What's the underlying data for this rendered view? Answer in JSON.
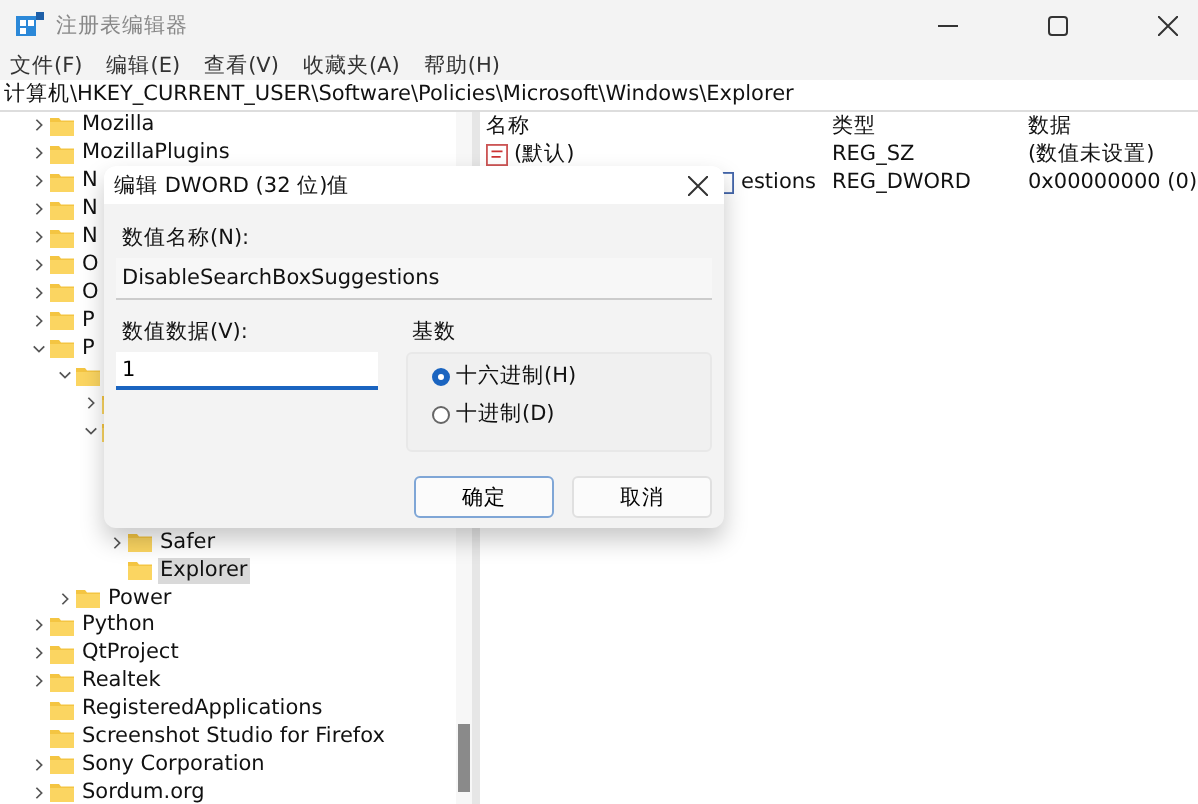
{
  "window": {
    "title": "注册表编辑器"
  },
  "menu": [
    "文件(F)",
    "编辑(E)",
    "查看(V)",
    "收藏夹(A)",
    "帮助(H)"
  ],
  "address": "计算机\\HKEY_CURRENT_USER\\Software\\Policies\\Microsoft\\Windows\\Explorer",
  "tree": [
    {
      "label": "Mozilla",
      "expanded": false,
      "selected": false
    },
    {
      "label": "MozillaPlugins",
      "expanded": false,
      "selected": false
    },
    {
      "label": "N",
      "expanded": false,
      "selected": false
    },
    {
      "label": "N",
      "expanded": false,
      "selected": false
    },
    {
      "label": "N",
      "expanded": false,
      "selected": false
    },
    {
      "label": "O",
      "expanded": false,
      "selected": false
    },
    {
      "label": "O",
      "expanded": false,
      "selected": false
    },
    {
      "label": "P",
      "expanded": false,
      "selected": false
    },
    {
      "label": "P",
      "expanded": true,
      "selected": false,
      "children": [
        {
          "expanded": true,
          "selected": false,
          "children": [
            {
              "expanded": false,
              "selected": false
            },
            {
              "expanded": true,
              "selected": false,
              "children": [
                {
                  "label": "Safer",
                  "expanded": false,
                  "selected": false
                },
                {
                  "label": "Explorer",
                  "selected": true
                }
              ]
            }
          ]
        },
        {
          "label": "Power",
          "expanded": false,
          "selected": false
        }
      ]
    },
    {
      "label": "Python",
      "expanded": false,
      "selected": false
    },
    {
      "label": "QtProject",
      "expanded": false,
      "selected": false
    },
    {
      "label": "Realtek",
      "expanded": false,
      "selected": false
    },
    {
      "label": "RegisteredApplications",
      "selected": false
    },
    {
      "label": "Screenshot Studio for Firefox",
      "selected": false
    },
    {
      "label": "Sony Corporation",
      "expanded": false,
      "selected": false
    },
    {
      "label": "Sordum.org",
      "expanded": false,
      "selected": false
    }
  ],
  "values": {
    "columns": [
      "名称",
      "类型",
      "数据"
    ],
    "rows": [
      {
        "name": "(默认)",
        "type": "REG_SZ",
        "data": "(数值未设置)",
        "kind": "string"
      },
      {
        "name": "estions",
        "type": "REG_DWORD",
        "data": "0x00000000 (0)",
        "kind": "dword"
      }
    ]
  },
  "dialog": {
    "title": "编辑 DWORD (32 位)值",
    "name_label": "数值名称(N):",
    "name_value": "DisableSearchBoxSuggestions",
    "data_label": "数值数据(V):",
    "data_value": "1",
    "base_label": "基数",
    "radios": [
      {
        "label": "十六进制(H)",
        "selected": true
      },
      {
        "label": "十进制(D)",
        "selected": false
      }
    ],
    "buttons": [
      {
        "label": "确定",
        "default": true
      },
      {
        "label": "取消",
        "default": false
      }
    ]
  }
}
